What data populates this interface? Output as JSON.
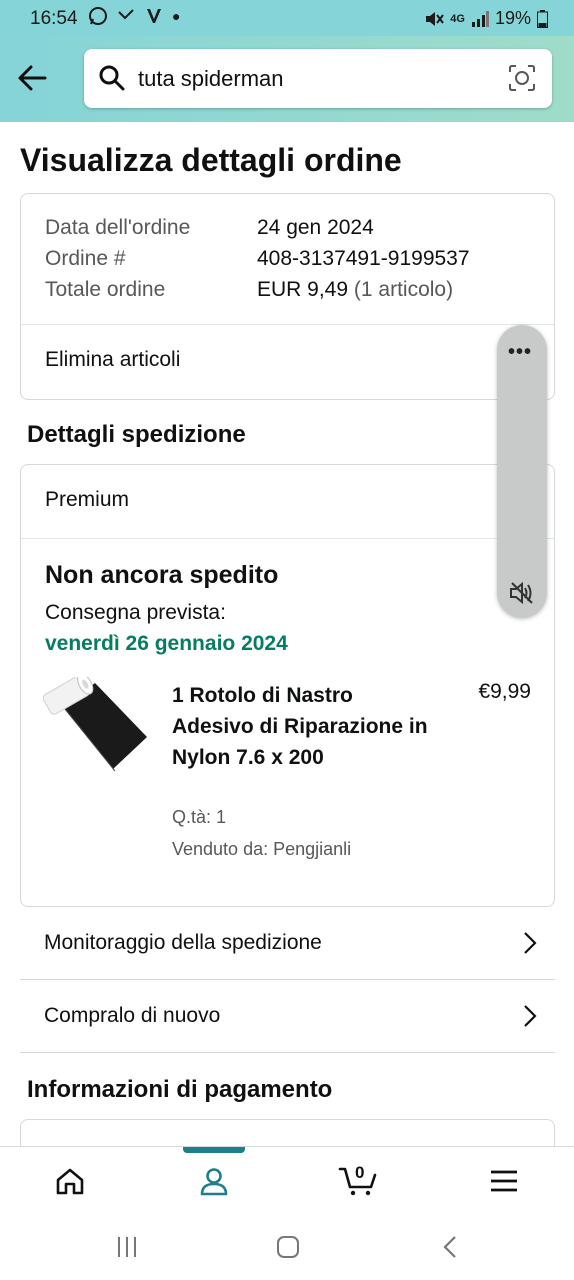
{
  "status_bar": {
    "time": "16:54",
    "network": "4G",
    "battery": "19%"
  },
  "search": {
    "query": "tuta spiderman"
  },
  "page": {
    "title": "Visualizza dettagli ordine"
  },
  "order_summary": {
    "date_label": "Data dell'ordine",
    "date_value": "24 gen 2024",
    "number_label": "Ordine #",
    "number_value": "408-3137491-9199537",
    "total_label": "Totale ordine",
    "total_value": "EUR 9,49",
    "total_items": "(1 articolo)",
    "delete_items": "Elimina articoli"
  },
  "shipment": {
    "section_title": "Dettagli spedizione",
    "shipping_type": "Premium",
    "status": "Non ancora spedito",
    "expected_label": "Consegna prevista:",
    "expected_date": "venerdì 26 gennaio 2024",
    "product": {
      "title": "1 Rotolo di Nastro Adesivo di Riparazione in Nylon 7.6 x 200",
      "price": "€9,99",
      "qty": "Q.tà: 1",
      "seller": "Venduto da: Pengjianli"
    }
  },
  "links": {
    "track": "Monitoraggio della spedizione",
    "buy_again": "Compralo di nuovo"
  },
  "payment": {
    "section_title": "Informazioni di pagamento"
  },
  "bottom_nav": {
    "cart_count": "0",
    "active_tab": "account"
  },
  "colors": {
    "header": "#85d4d8",
    "delivery_green": "#067d62",
    "nav_active": "#1e7f8c"
  }
}
